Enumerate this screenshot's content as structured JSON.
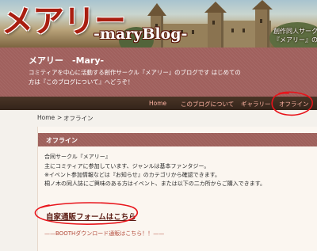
{
  "banner": {
    "logo_text": "メアリー",
    "sub_logo_text": "-maryBlog-",
    "caption_line1": "創作同人サークル",
    "caption_line2": "『メアリー』の活動"
  },
  "header": {
    "title": "メアリー　-Mary-",
    "description": "コミティアを中心に活動する創作サークル『メアリー』のブログです はじめての方は『このブログについて』へどうぞ！"
  },
  "nav": {
    "items": [
      {
        "label": "Home"
      },
      {
        "label": "このブログについて"
      },
      {
        "label": "ギャラリー"
      },
      {
        "label": "オフライン"
      }
    ]
  },
  "breadcrumb": {
    "home": "Home",
    "separator": ">",
    "current": "オフライン"
  },
  "main": {
    "heading": "オフライン",
    "paragraphs": [
      "合同サークル『メアリー』",
      "主にコミティアに参加しています、ジャンルは基本ファンタジー。",
      "※イベント参加情報などは『お知らせ』のカテゴリから確認できます。",
      "桐ノ木の同人誌にご興味のある方はイベント、または以下の二カ所からご購入できます。"
    ],
    "link_main": "自家通販フォームはこちら",
    "link_booth": "——BOOTHダウンロード通販はこちら！！——"
  },
  "colors": {
    "logo_red": "#a91e10",
    "band": "#a0605d",
    "nav_bg": "#3b2a1e",
    "nav_text": "#ffb3a3",
    "annotation_red": "#e8141b"
  },
  "annotations": {
    "nav_circle": "red hand-drawn circle around オフライン nav item",
    "link_circle": "red hand-drawn circle around 自家通販フォームはこちら"
  }
}
